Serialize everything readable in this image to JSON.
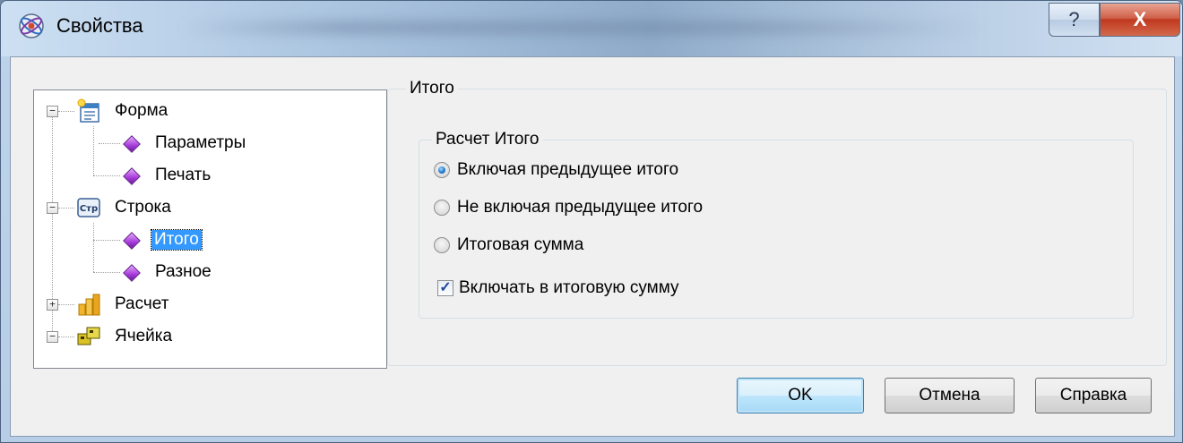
{
  "window": {
    "title": "Свойства",
    "help_label": "?",
    "close_label": "X"
  },
  "tree": {
    "items": [
      {
        "label": "Форма",
        "level": 0,
        "expanded": true
      },
      {
        "label": "Параметры",
        "level": 1
      },
      {
        "label": "Печать",
        "level": 1
      },
      {
        "label": "Строка",
        "level": 0,
        "expanded": true
      },
      {
        "label": "Итого",
        "level": 1,
        "selected": true
      },
      {
        "label": "Разное",
        "level": 1
      },
      {
        "label": "Расчет",
        "level": 0,
        "expanded": false
      },
      {
        "label": "Ячейка",
        "level": 0,
        "expanded": true
      }
    ],
    "stroka_icon_text": "Стр"
  },
  "panel": {
    "group_title": "Итого",
    "inner_group_title": "Расчет Итого",
    "options": [
      {
        "label": "Включая предыдущее итого",
        "checked": true
      },
      {
        "label": "Не включая предыдущее итого",
        "checked": false
      },
      {
        "label": "Итоговая сумма",
        "checked": false
      }
    ],
    "checkbox": {
      "label": "Включать в итоговую сумму",
      "checked": true
    }
  },
  "buttons": {
    "ok": "OK",
    "cancel": "Отмена",
    "help": "Справка"
  },
  "colors": {
    "selection": "#3399ff",
    "close_button": "#c0391f"
  }
}
